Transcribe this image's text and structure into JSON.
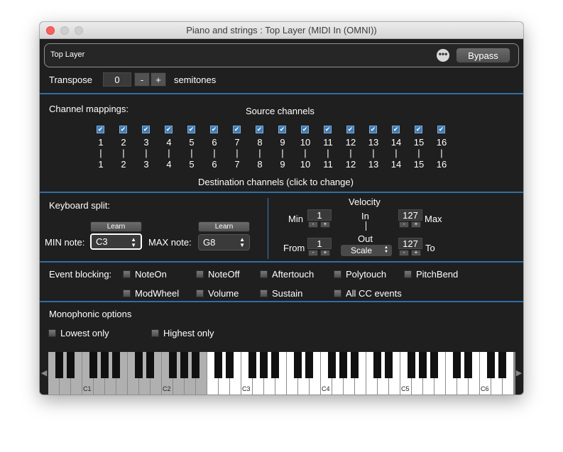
{
  "window": {
    "title": "Piano and strings : Top Layer (MIDI In (OMNI))"
  },
  "header": {
    "layer_name": "Top Layer",
    "more_label": "•••",
    "bypass_label": "Bypass"
  },
  "transpose": {
    "label": "Transpose",
    "value": "0",
    "minus": "-",
    "plus": "+",
    "unit": "semitones"
  },
  "channels": {
    "label": "Channel mappings:",
    "source_label": "Source channels",
    "destination_label": "Destination channels (click to change)",
    "separator": "|",
    "check_glyph": "✔",
    "source": [
      "1",
      "2",
      "3",
      "4",
      "5",
      "6",
      "7",
      "8",
      "9",
      "10",
      "11",
      "12",
      "13",
      "14",
      "15",
      "16"
    ],
    "destination": [
      "1",
      "2",
      "3",
      "4",
      "5",
      "6",
      "7",
      "8",
      "9",
      "10",
      "11",
      "12",
      "13",
      "14",
      "15",
      "16"
    ]
  },
  "split": {
    "label": "Keyboard split:",
    "learn_label": "Learn",
    "min_label": "MIN note:",
    "min_value": "C3",
    "max_label": "MAX note:",
    "max_value": "G8"
  },
  "velocity": {
    "label": "Velocity",
    "min_label": "Min",
    "min_value": "1",
    "max_label": "Max",
    "max_value": "127",
    "in_label": "In",
    "out_label": "Out",
    "mode": "Scale",
    "from_label": "From",
    "from_value": "1",
    "to_label": "To",
    "to_value": "127",
    "minus": "-",
    "plus": "+"
  },
  "blocking": {
    "label": "Event blocking:",
    "row1": [
      "NoteOn",
      "NoteOff",
      "Aftertouch",
      "Polytouch",
      "PitchBend"
    ],
    "row2": [
      "ModWheel",
      "Volume",
      "Sustain",
      "All CC events"
    ]
  },
  "mono": {
    "label": "Monophonic options",
    "options": [
      "Lowest only",
      "Highest only"
    ]
  },
  "keyboard": {
    "labels": [
      "C1",
      "C2",
      "C3",
      "C4",
      "C5",
      "C6"
    ],
    "left_arrow": "◀",
    "right_arrow": "▶",
    "active_from_label": "C3",
    "colors": {
      "inactive_white": "#b0b0b0",
      "active_white": "#ffffff",
      "black": "#111111"
    }
  },
  "colors": {
    "panel": "#1f1f1f",
    "separator": "#2d6ea5",
    "checkbox": "#3f7ab3"
  }
}
